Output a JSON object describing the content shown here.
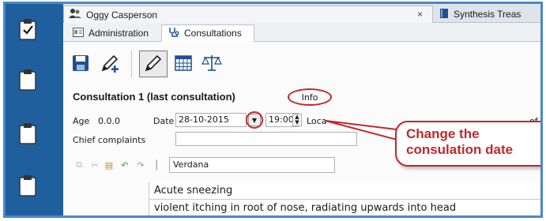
{
  "window_tabs": [
    {
      "label": "Oggy Casperson",
      "close": "×"
    },
    {
      "label": "Synthesis Treas"
    }
  ],
  "sub_tabs": [
    {
      "label": "Administration"
    },
    {
      "label": "Consultations"
    }
  ],
  "consultation": {
    "title": "Consultation 1 (last consultation)",
    "info_label": "Info",
    "age_label": "Age",
    "age_value": "0.0.0",
    "date_label": "Date",
    "date_value": "28-10-2015",
    "time_value": "19:00",
    "location_label": "Loca",
    "right_clip": "of",
    "chief_complaints_label": "Chief complaints"
  },
  "editor": {
    "font": "Verdana",
    "lines": [
      "Acute sneezing",
      "violent itching in root of nose, radiating upwards into head"
    ]
  },
  "callout": {
    "line1": "Change the",
    "line2": "consulation date"
  },
  "colors": {
    "frame": "#1f5f9e",
    "annotation": "#c0282a",
    "accent_blue": "#1f4f8f"
  }
}
